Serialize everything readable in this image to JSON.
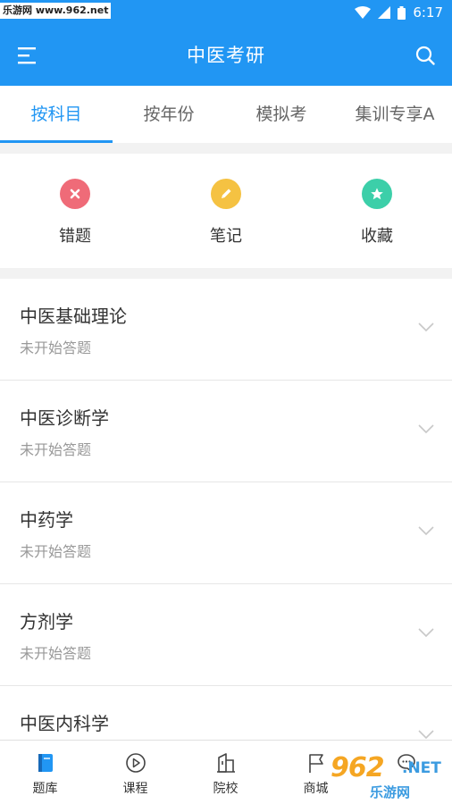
{
  "status_bar": {
    "watermark": "乐游网 www.962.net",
    "time": "6:17"
  },
  "app_bar": {
    "title": "中医考研"
  },
  "tabs": [
    {
      "label": "按科目",
      "active": true
    },
    {
      "label": "按年份",
      "active": false
    },
    {
      "label": "模拟考",
      "active": false
    },
    {
      "label": "集训专享A",
      "active": false
    }
  ],
  "quick_actions": [
    {
      "label": "错题",
      "icon": "x-icon",
      "color": "#ef6b78"
    },
    {
      "label": "笔记",
      "icon": "pencil-icon",
      "color": "#f5c242"
    },
    {
      "label": "收藏",
      "icon": "star-icon",
      "color": "#3ccfa9"
    }
  ],
  "subjects": [
    {
      "title": "中医基础理论",
      "status": "未开始答题"
    },
    {
      "title": "中医诊断学",
      "status": "未开始答题"
    },
    {
      "title": "中药学",
      "status": "未开始答题"
    },
    {
      "title": "方剂学",
      "status": "未开始答题"
    },
    {
      "title": "中医内科学",
      "status": ""
    }
  ],
  "bottom_nav": [
    {
      "label": "题库",
      "icon": "book-icon"
    },
    {
      "label": "课程",
      "icon": "play-icon"
    },
    {
      "label": "院校",
      "icon": "building-icon"
    },
    {
      "label": "商城",
      "icon": "flag-icon"
    },
    {
      "label": "",
      "icon": "chat-icon"
    }
  ],
  "watermark_logo": {
    "number": "962",
    "suffix": ".NET",
    "text": "乐游网"
  },
  "colors": {
    "primary": "#2196f3"
  }
}
